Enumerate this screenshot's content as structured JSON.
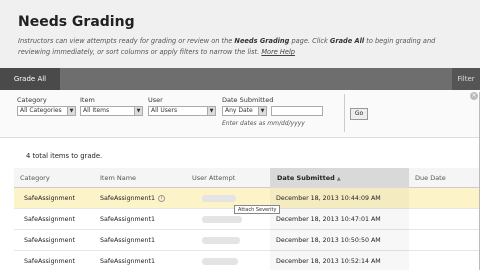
{
  "page": {
    "title": "Needs Grading",
    "instructions": {
      "part1": "Instructors can view attempts ready for grading or review on the ",
      "page_name": "Needs Grading",
      "part2": " page. Click ",
      "grade_all_ref": "Grade All",
      "part3": " to begin grading and reviewing immediately, or sort columns or apply filters to narrow the list. ",
      "more_help": "More Help"
    }
  },
  "actionbar": {
    "grade_all_label": "Grade All",
    "filter_label": "Filter"
  },
  "filters": {
    "category": {
      "label": "Category",
      "value": "All Categories"
    },
    "item": {
      "label": "Item",
      "value": "All Items"
    },
    "user": {
      "label": "User",
      "value": "All Users"
    },
    "date": {
      "label": "Date Submitted",
      "value": "Any Date",
      "hint": "Enter dates as mm/dd/yyyy"
    },
    "go_label": "Go"
  },
  "summary": {
    "total_text": "4 total items to grade."
  },
  "table": {
    "columns": [
      "Category",
      "Item Name",
      "User Attempt",
      "Date Submitted",
      "Due Date"
    ],
    "rows": [
      {
        "category": "SafeAssignment",
        "item": "SafeAssignment1",
        "date": "December 18, 2013 10:44:09 AM"
      },
      {
        "category": "SafeAssignment",
        "item": "SafeAssignment1",
        "date": "December 18, 2013 10:47:01 AM"
      },
      {
        "category": "SafeAssignment",
        "item": "SafeAssignment1",
        "date": "December 18, 2013 10:50:50 AM"
      },
      {
        "category": "SafeAssignment",
        "item": "SafeAssignment1",
        "date": "December 18, 2013 10:52:14 AM"
      }
    ],
    "tooltip": "Attach Severity"
  }
}
